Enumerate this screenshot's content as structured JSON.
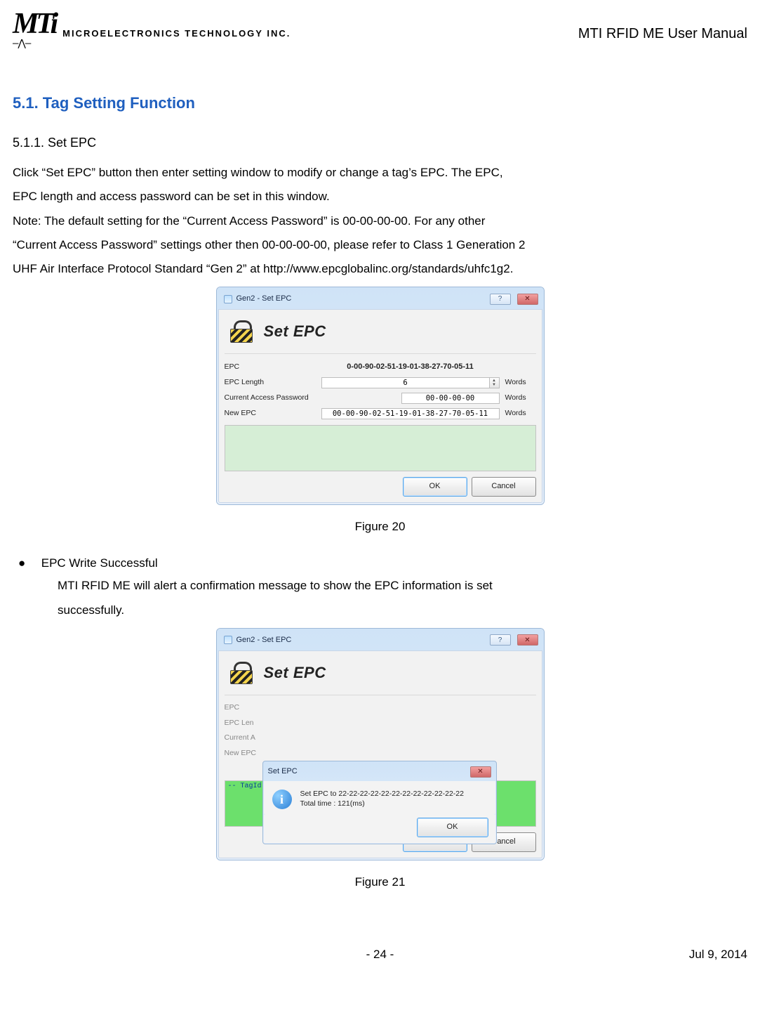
{
  "header": {
    "logo_mark": "MTi",
    "logo_pulse": "—⋀—",
    "logo_company": "MICROELECTRONICS TECHNOLOGY INC.",
    "doc_title": "MTI RFID ME User Manual"
  },
  "section": {
    "heading": "5.1. Tag Setting Function",
    "sub_heading": "5.1.1.  Set EPC",
    "para1a": "Click “Set EPC” button then enter setting window to modify or change a tag’s EPC. The EPC,",
    "para1b": "EPC length and access password can be set in this window.",
    "para2a": "Note: The default setting for the “Current Access Password” is 00-00-00-00.    For any other",
    "para2b": "“Current Access Password” settings other then 00-00-00-00, please refer to Class 1 Generation 2",
    "para2c": "UHF Air Interface Protocol Standard “Gen 2” at http://www.epcglobalinc.org/standards/uhfc1g2."
  },
  "fig20": {
    "caption": "Figure 20",
    "window_title": "Gen2 - Set EPC",
    "hero_title": "Set EPC",
    "rows": {
      "epc_label": "EPC",
      "epc_value": "0-00-90-02-51-19-01-38-27-70-05-11",
      "len_label": "EPC Length",
      "len_value": "6",
      "len_unit": "Words",
      "pwd_label": "Current Access Password",
      "pwd_value": "00-00-00-00",
      "pwd_unit": "Words",
      "new_label": "New EPC",
      "new_value": "00-00-90-02-51-19-01-38-27-70-05-11",
      "new_unit": "Words"
    },
    "buttons": {
      "ok": "OK",
      "cancel": "Cancel"
    }
  },
  "bullet": {
    "title": "EPC Write Successful",
    "body1": "MTI RFID ME will alert a confirmation message to show the EPC information is set",
    "body2": "successfully."
  },
  "fig21": {
    "caption": "Figure 21",
    "window_title": "Gen2 - Set EPC",
    "hero_title": "Set EPC",
    "msg_title": "Set EPC",
    "msg_line1": "Set EPC to 22-22-22-22-22-22-22-22-22-22-22-22",
    "msg_line2": "Total time : 121(ms)",
    "msg_ok": "OK",
    "log_line": "-- TagId set to 22-22-22-22-22-22-22-22-22-22-22-22 - OK --",
    "rows": {
      "epc_label": "EPC",
      "len_label": "EPC Len",
      "pwd_label": "Current A",
      "new_label": "New EPC"
    },
    "buttons": {
      "ok": "OK",
      "cancel": "Cancel"
    }
  },
  "footer": {
    "left": "",
    "center": "-  24  -",
    "right": "Jul  9,  2014"
  }
}
